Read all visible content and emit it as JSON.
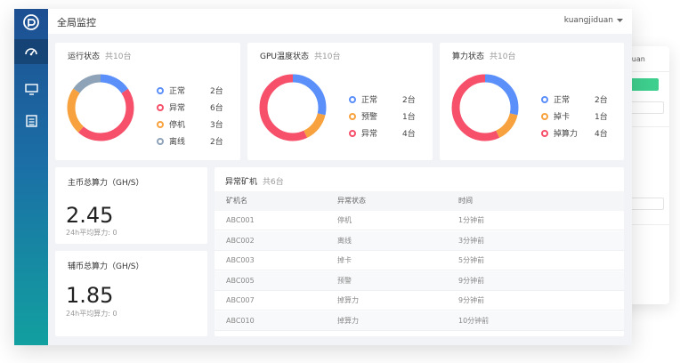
{
  "header": {
    "title": "全局监控",
    "user": "kuangjiduan"
  },
  "ghost": {
    "user": "ijiduan",
    "btn": ""
  },
  "run_status": {
    "title": "运行状态",
    "subtitle": "共10台",
    "items": [
      {
        "label": "正常",
        "value": "2台",
        "n": 2,
        "color": "#5b8ff9"
      },
      {
        "label": "异常",
        "value": "6台",
        "n": 6,
        "color": "#f6506b"
      },
      {
        "label": "停机",
        "value": "3台",
        "n": 3,
        "color": "#f7a23e"
      },
      {
        "label": "离线",
        "value": "2台",
        "n": 2,
        "color": "#8fa3b8"
      }
    ]
  },
  "gpu_status": {
    "title": "GPU温度状态",
    "subtitle": "共10台",
    "items": [
      {
        "label": "正常",
        "value": "2台",
        "n": 2,
        "color": "#5b8ff9"
      },
      {
        "label": "预警",
        "value": "1台",
        "n": 1,
        "color": "#f7a23e"
      },
      {
        "label": "异常",
        "value": "4台",
        "n": 4,
        "color": "#f6506b"
      }
    ]
  },
  "hash_status": {
    "title": "算力状态",
    "subtitle": "共10台",
    "items": [
      {
        "label": "正常",
        "value": "2台",
        "n": 2,
        "color": "#5b8ff9"
      },
      {
        "label": "掉卡",
        "value": "1台",
        "n": 1,
        "color": "#f7a23e"
      },
      {
        "label": "掉算力",
        "value": "4台",
        "n": 4,
        "color": "#f6506b"
      }
    ]
  },
  "main_coin": {
    "title": "主币总算力（GH/S）",
    "value": "2.45",
    "sub": "24h平均算力: 0"
  },
  "aux_coin": {
    "title": "辅币总算力（GH/S）",
    "value": "1.85",
    "sub": "24h平均算力: 0"
  },
  "abnormal": {
    "title": "异常矿机",
    "subtitle": "共6台",
    "columns": [
      "矿机名",
      "异常状态",
      "时间"
    ],
    "rows": [
      [
        "ABC001",
        "停机",
        "1分钟前"
      ],
      [
        "ABC002",
        "离线",
        "3分钟前"
      ],
      [
        "ABC003",
        "掉卡",
        "5分钟前"
      ],
      [
        "ABC005",
        "预警",
        "9分钟前"
      ],
      [
        "ABC007",
        "掉算力",
        "9分钟前"
      ],
      [
        "ABC010",
        "掉算力",
        "10分钟前"
      ]
    ]
  }
}
